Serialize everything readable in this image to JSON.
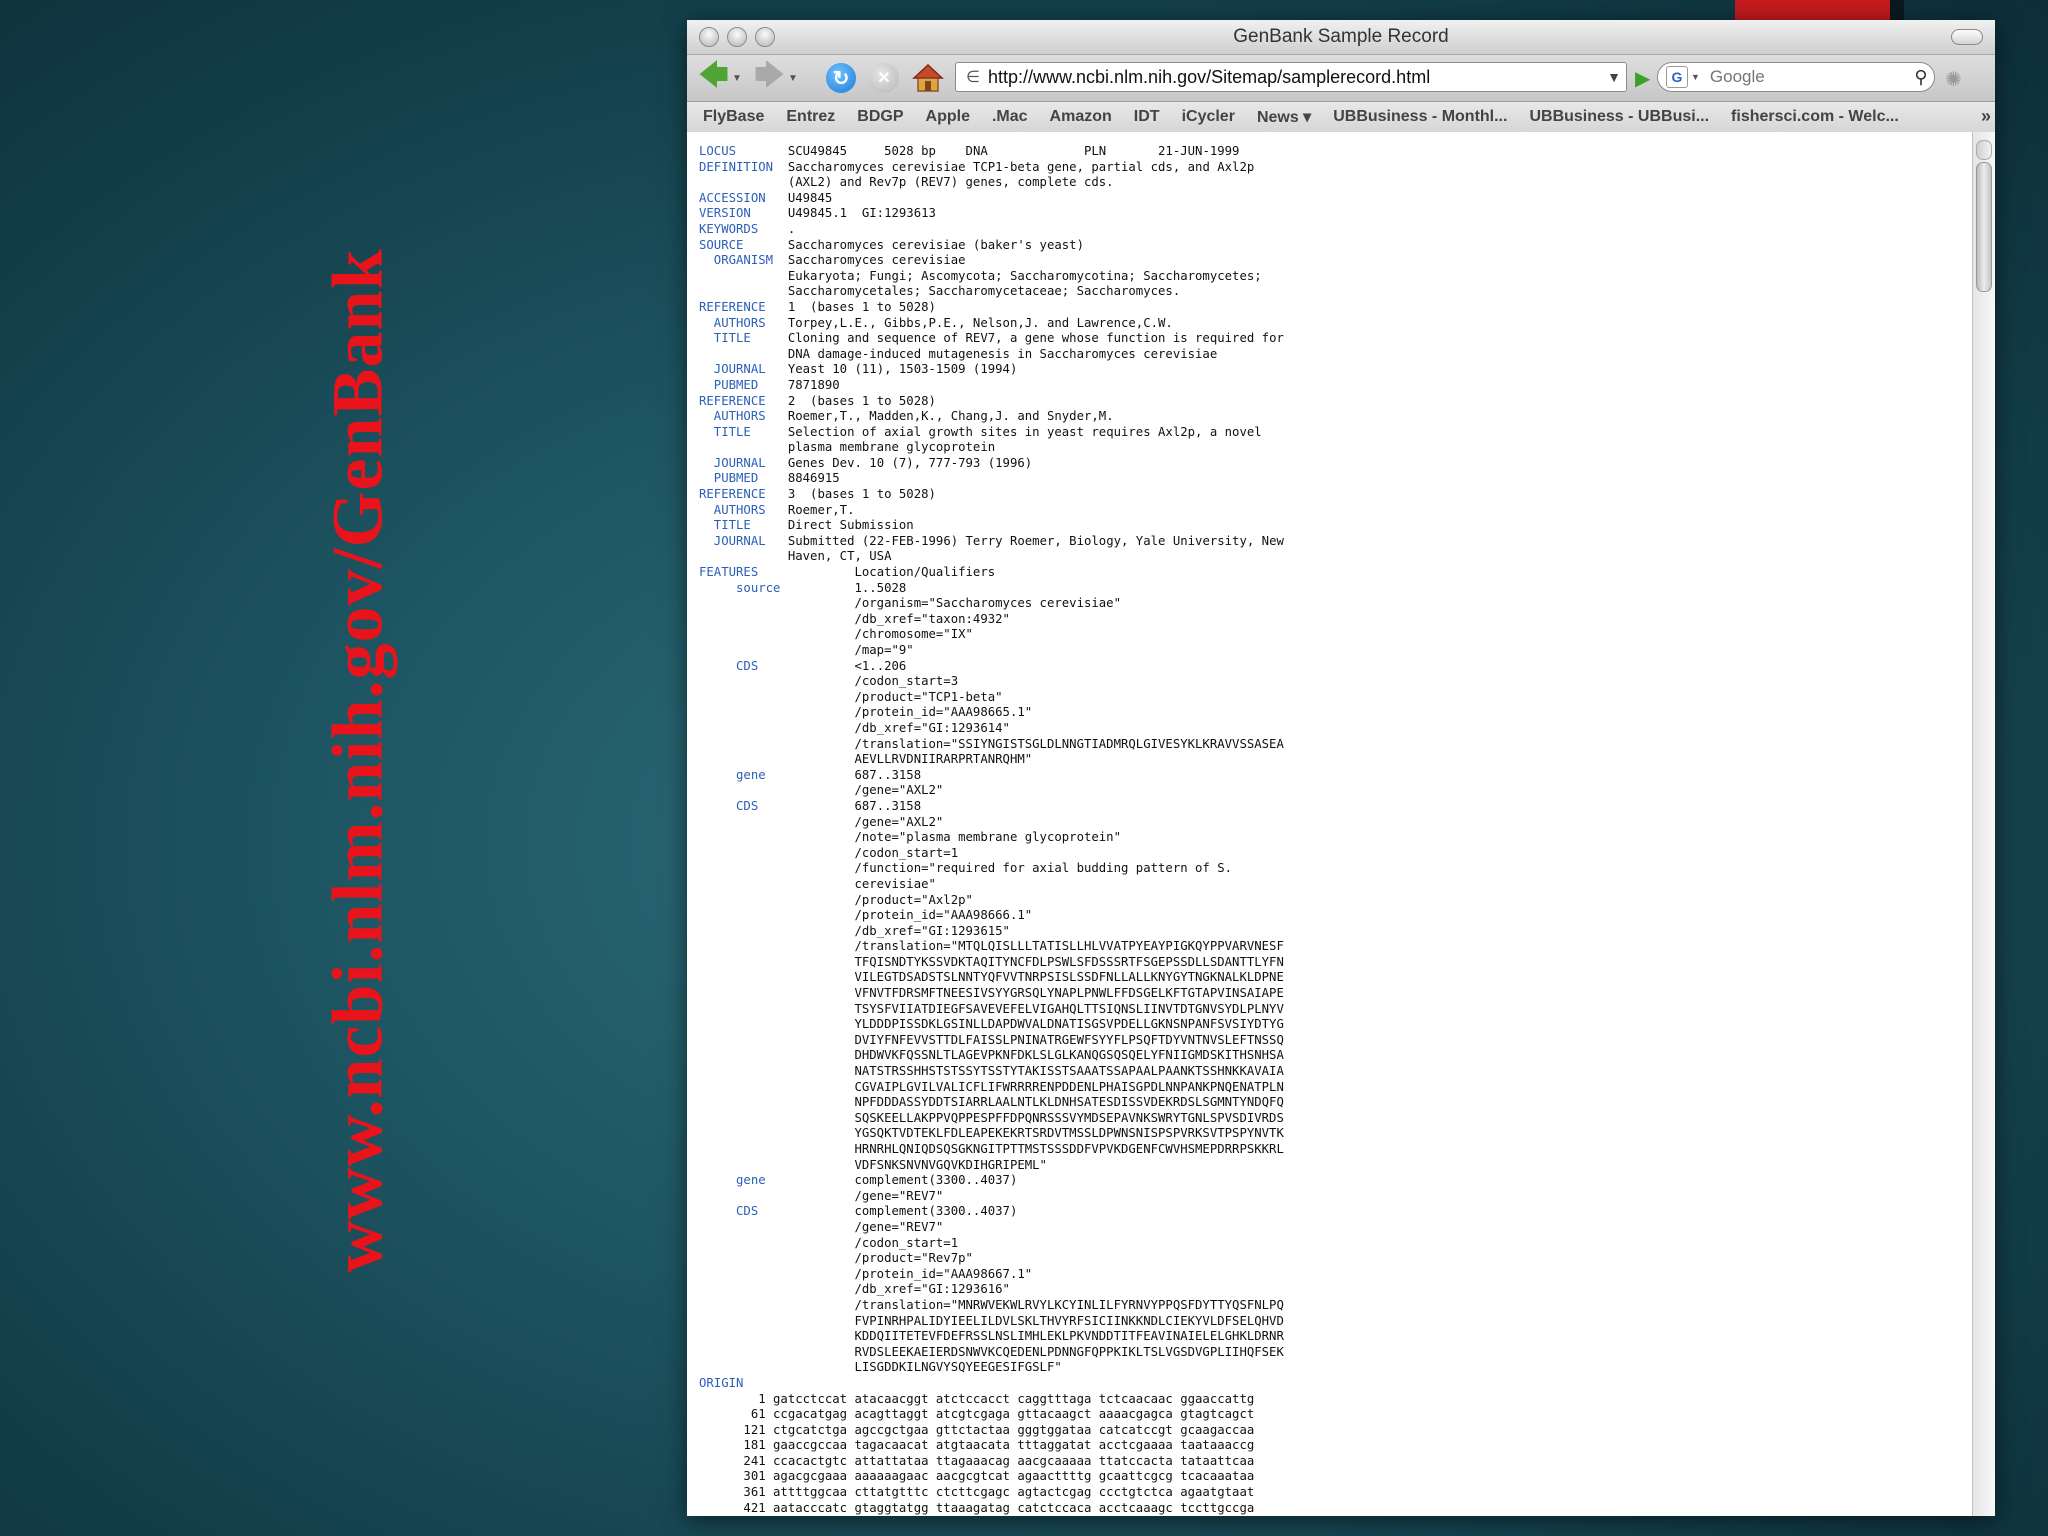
{
  "slide": {
    "title": "www.ncbi.nlm.nih.gov/GenBank"
  },
  "window": {
    "title": "GenBank Sample Record"
  },
  "toolbar": {
    "url": "http://www.ncbi.nlm.nih.gov/Sitemap/samplerecord.html",
    "search_placeholder": "Google"
  },
  "bookmarks": [
    "FlyBase",
    "Entrez",
    "BDGP",
    "Apple",
    ".Mac",
    "Amazon",
    "IDT",
    "iCycler",
    "News ▾",
    "UBBusiness - Monthl...",
    "UBBusiness - UBBusi...",
    "fishersci.com - Welc..."
  ],
  "record": {
    "lines": [
      [
        "LOCUS",
        "       SCU49845     5028 bp    DNA             PLN       21-JUN-1999"
      ],
      [
        "DEFINITION",
        "  Saccharomyces cerevisiae TCP1-beta gene, partial cds, and Axl2p"
      ],
      [
        "",
        "            (AXL2) and Rev7p (REV7) genes, complete cds."
      ],
      [
        "ACCESSION",
        "   U49845"
      ],
      [
        "VERSION",
        "     U49845.1  GI:1293613"
      ],
      [
        "KEYWORDS",
        "    ."
      ],
      [
        "SOURCE",
        "      Saccharomyces cerevisiae (baker's yeast)"
      ],
      [
        "  ORGANISM",
        "  Saccharomyces cerevisiae"
      ],
      [
        "",
        "            Eukaryota; Fungi; Ascomycota; Saccharomycotina; Saccharomycetes;"
      ],
      [
        "",
        "            Saccharomycetales; Saccharomycetaceae; Saccharomyces."
      ],
      [
        "REFERENCE",
        "   1  (bases 1 to 5028)"
      ],
      [
        "  AUTHORS",
        "   Torpey,L.E., Gibbs,P.E., Nelson,J. and Lawrence,C.W."
      ],
      [
        "  TITLE",
        "     Cloning and sequence of REV7, a gene whose function is required for"
      ],
      [
        "",
        "            DNA damage-induced mutagenesis in Saccharomyces cerevisiae"
      ],
      [
        "  JOURNAL",
        "   Yeast 10 (11), 1503-1509 (1994)"
      ],
      [
        "  PUBMED",
        "    7871890"
      ],
      [
        "REFERENCE",
        "   2  (bases 1 to 5028)"
      ],
      [
        "  AUTHORS",
        "   Roemer,T., Madden,K., Chang,J. and Snyder,M."
      ],
      [
        "  TITLE",
        "     Selection of axial growth sites in yeast requires Axl2p, a novel"
      ],
      [
        "",
        "            plasma membrane glycoprotein"
      ],
      [
        "  JOURNAL",
        "   Genes Dev. 10 (7), 777-793 (1996)"
      ],
      [
        "  PUBMED",
        "    8846915"
      ],
      [
        "REFERENCE",
        "   3  (bases 1 to 5028)"
      ],
      [
        "  AUTHORS",
        "   Roemer,T."
      ],
      [
        "  TITLE",
        "     Direct Submission"
      ],
      [
        "  JOURNAL",
        "   Submitted (22-FEB-1996) Terry Roemer, Biology, Yale University, New"
      ],
      [
        "",
        "            Haven, CT, USA"
      ],
      [
        "FEATURES",
        "             Location/Qualifiers"
      ],
      [
        "     source",
        "          1..5028"
      ],
      [
        "",
        "                     /organism=\"Saccharomyces cerevisiae\""
      ],
      [
        "",
        "                     /db_xref=\"taxon:4932\""
      ],
      [
        "",
        "                     /chromosome=\"IX\""
      ],
      [
        "",
        "                     /map=\"9\""
      ],
      [
        "     CDS",
        "             <1..206"
      ],
      [
        "",
        "                     /codon_start=3"
      ],
      [
        "",
        "                     /product=\"TCP1-beta\""
      ],
      [
        "",
        "                     /protein_id=\"AAA98665.1\""
      ],
      [
        "",
        "                     /db_xref=\"GI:1293614\""
      ],
      [
        "",
        "                     /translation=\"SSIYNGISTSGLDLNNGTIADMRQLGIVESYKLKRAVVSSASEA"
      ],
      [
        "",
        "                     AEVLLRVDNIIRARPRTANRQHM\""
      ],
      [
        "     gene",
        "            687..3158"
      ],
      [
        "",
        "                     /gene=\"AXL2\""
      ],
      [
        "     CDS",
        "             687..3158"
      ],
      [
        "",
        "                     /gene=\"AXL2\""
      ],
      [
        "",
        "                     /note=\"plasma membrane glycoprotein\""
      ],
      [
        "",
        "                     /codon_start=1"
      ],
      [
        "",
        "                     /function=\"required for axial budding pattern of S."
      ],
      [
        "",
        "                     cerevisiae\""
      ],
      [
        "",
        "                     /product=\"Axl2p\""
      ],
      [
        "",
        "                     /protein_id=\"AAA98666.1\""
      ],
      [
        "",
        "                     /db_xref=\"GI:1293615\""
      ],
      [
        "",
        "                     /translation=\"MTQLQISLLLTATISLLHLVVATPYEAYPIGKQYPPVARVNESF"
      ],
      [
        "",
        "                     TFQISNDTYKSSVDKTAQITYNCFDLPSWLSFDSSSRTFSGEPSSDLLSDANTTLYFN"
      ],
      [
        "",
        "                     VILEGTDSADSTSLNNTYQFVVTNRPSISLSSDFNLLALLKNYGYTNGKNALKLDPNE"
      ],
      [
        "",
        "                     VFNVTFDRSMFTNEESIVSYYGRSQLYNAPLPNWLFFDSGELKFTGTAPVINSAIAPE"
      ],
      [
        "",
        "                     TSYSFVIIATDIEGFSAVEVEFELVIGAHQLTTSIQNSLIINVTDTGNVSYDLPLNYV"
      ],
      [
        "",
        "                     YLDDDPISSDKLGSINLLDAPDWVALDNATISGSVPDELLGKNSNPANFSVSIYDTYG"
      ],
      [
        "",
        "                     DVIYFNFEVVSTTDLFAISSLPNINATRGEWFSYYFLPSQFTDYVNTNVSLEFTNSSQ"
      ],
      [
        "",
        "                     DHDWVKFQSSNLTLAGEVPKNFDKLSLGLKANQGSQSQELYFNIIGMDSKITHSNHSA"
      ],
      [
        "",
        "                     NATSTRSSHHSTSTSSYTSSTYTAKISSTSAAATSSAPAALPAANKTSSHNKKAVAIA"
      ],
      [
        "",
        "                     CGVAIPLGVILVALICFLIFWRRRRENPDDENLPHAISGPDLNNPANKPNQENATPLN"
      ],
      [
        "",
        "                     NPFDDDASSYDDTSIARRLAALNTLKLDNHSATESDISSVDEKRDSLSGMNTYNDQFQ"
      ],
      [
        "",
        "                     SQSKEELLAKPPVQPPESPFFDPQNRSSSVYMDSEPAVNKSWRYTGNLSPVSDIVRDS"
      ],
      [
        "",
        "                     YGSQKTVDTEKLFDLEAPEKEKRTSRDVTMSSLDPWNSNISPSPVRKSVTPSPYNVTK"
      ],
      [
        "",
        "                     HRNRHLQNIQDSQSGKNGITPTTMSTSSSDDFVPVKDGENFCWVHSMEPDRRPSKKRL"
      ],
      [
        "",
        "                     VDFSNKSNVNVGQVKDIHGRIPEML\""
      ],
      [
        "     gene",
        "            complement(3300..4037)"
      ],
      [
        "",
        "                     /gene=\"REV7\""
      ],
      [
        "     CDS",
        "             complement(3300..4037)"
      ],
      [
        "",
        "                     /gene=\"REV7\""
      ],
      [
        "",
        "                     /codon_start=1"
      ],
      [
        "",
        "                     /product=\"Rev7p\""
      ],
      [
        "",
        "                     /protein_id=\"AAA98667.1\""
      ],
      [
        "",
        "                     /db_xref=\"GI:1293616\""
      ],
      [
        "",
        "                     /translation=\"MNRWVEKWLRVYLKCYINLILFYRNVYPPQSFDYTTYQSFNLPQ"
      ],
      [
        "",
        "                     FVPINRHPALIDYIEELILDVLSKLTHVYRFSICIINKKNDLCIEKYVLDFSELQHVD"
      ],
      [
        "",
        "                     KDDQIITETEVFDEFRSSLNSLIMHLEKLPKVNDDTITFEAVINAIELELGHKLDRNR"
      ],
      [
        "",
        "                     RVDSLEEKAEIERDSNWVKCQEDENLPDNNGFQPPKIKLTSLVGSDVGPLIIHQFSEK"
      ],
      [
        "",
        "                     LISGDDKILNGVYSQYEEGESIFGSLF\""
      ],
      [
        "ORIGIN",
        ""
      ],
      [
        "",
        "        1 gatcctccat atacaacggt atctccacct caggtttaga tctcaacaac ggaaccattg"
      ],
      [
        "",
        "       61 ccgacatgag acagttaggt atcgtcgaga gttacaagct aaaacgagca gtagtcagct"
      ],
      [
        "",
        "      121 ctgcatctga agccgctgaa gttctactaa gggtggataa catcatccgt gcaagaccaa"
      ],
      [
        "",
        "      181 gaaccgccaa tagacaacat atgtaacata tttaggatat acctcgaaaa taataaaccg"
      ],
      [
        "",
        "      241 ccacactgtc attattataa ttagaaacag aacgcaaaaa ttatccacta tataattcaa"
      ],
      [
        "",
        "      301 agacgcgaaa aaaaaagaac aacgcgtcat agaacttttg gcaattcgcg tcacaaataa"
      ],
      [
        "",
        "      361 attttggcaa cttatgtttc ctcttcgagc agtactcgag ccctgtctca agaatgtaat"
      ],
      [
        "",
        "      421 aatacccatc gtaggtatgg ttaaagatag catctccaca acctcaaagc tccttgccga"
      ]
    ]
  }
}
